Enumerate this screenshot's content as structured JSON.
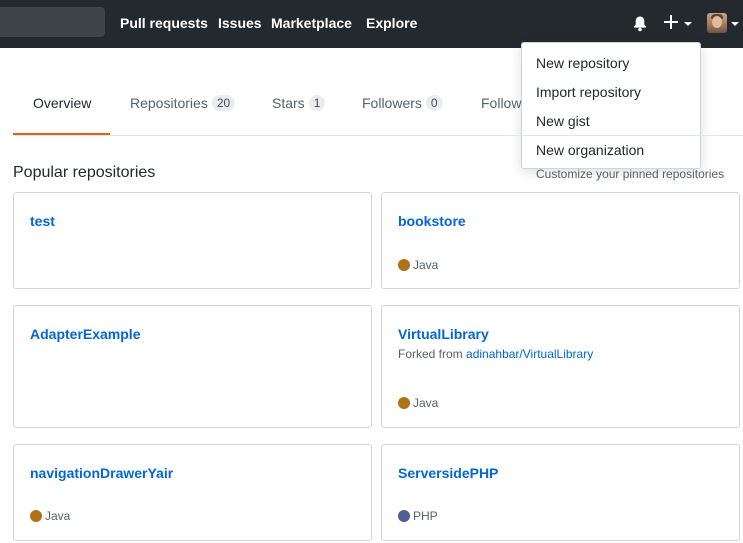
{
  "header": {
    "nav": [
      "Pull requests",
      "Issues",
      "Marketplace",
      "Explore"
    ],
    "icons": {
      "notifications": "bell-icon",
      "create": "plus-icon",
      "avatar": "user-avatar"
    }
  },
  "dropdown": {
    "items": [
      "New repository",
      "Import repository",
      "New gist",
      "New organization"
    ]
  },
  "tabs": [
    {
      "label": "Overview",
      "count": "",
      "selected": true
    },
    {
      "label": "Repositories",
      "count": "20"
    },
    {
      "label": "Stars",
      "count": "1"
    },
    {
      "label": "Followers",
      "count": "0"
    },
    {
      "label": "Follow",
      "count": ""
    }
  ],
  "colors": {
    "accent": "#e36209",
    "link": "#0366d6",
    "java": "#b07219",
    "php": "#4F5D95"
  },
  "main": {
    "section_title": "Popular repositories",
    "customize_link": "Customize your pinned repositories",
    "repos": [
      {
        "name": "test",
        "language": ""
      },
      {
        "name": "bookstore",
        "language": "Java"
      },
      {
        "name": "AdapterExample",
        "language": ""
      },
      {
        "name": "VirtualLibrary",
        "fork_prefix": "Forked from",
        "fork_source": "adinahbar/VirtualLibrary",
        "language": "Java"
      },
      {
        "name": "navigationDrawerYair",
        "language": "Java"
      },
      {
        "name": "ServersidePHP",
        "language": "PHP"
      }
    ]
  }
}
